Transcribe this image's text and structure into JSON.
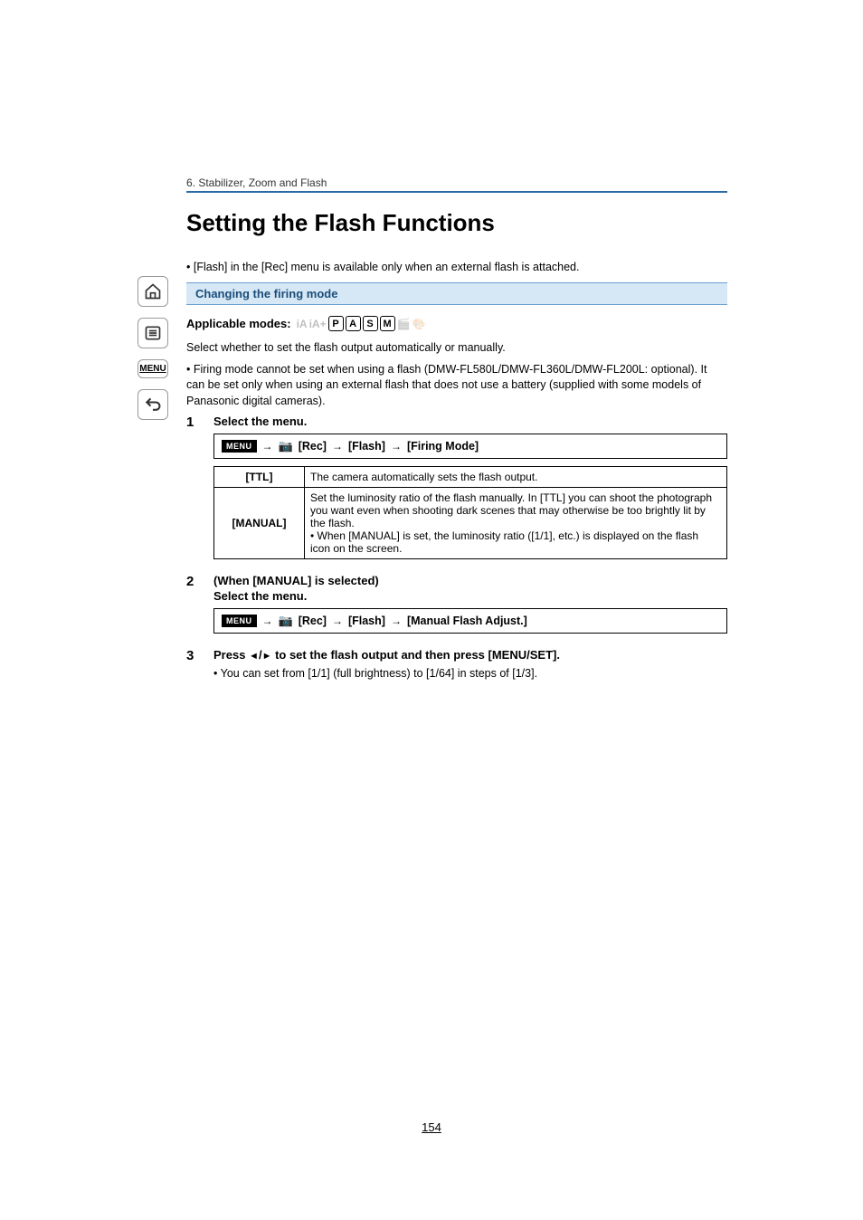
{
  "sidebar": {
    "menu_label": "MENU"
  },
  "header": {
    "section": "6. Stabilizer, Zoom and Flash"
  },
  "title": "Setting the Flash Functions",
  "note_flash": "• [Flash] in the [Rec] menu is available only when an external flash is attached.",
  "subheading": "Changing the firing mode",
  "applicable_label": "Applicable modes:",
  "body": {
    "p1": "Select whether to set the flash output automatically or manually.",
    "p2": "• Firing mode cannot be set when using a flash (DMW-FL580L/DMW-FL360L/DMW-FL200L: optional). It can be set only when using an external flash that does not use a battery (supplied with some models of Panasonic digital cameras)."
  },
  "steps": {
    "s1": {
      "num": "1",
      "title": "Select the menu.",
      "menu_label": "MENU",
      "path": {
        "a": "[Rec]",
        "b": "[Flash]",
        "c": "[Firing Mode]"
      },
      "options": [
        {
          "label": "[TTL]",
          "desc": "The camera automatically sets the flash output."
        },
        {
          "label": "[MANUAL]",
          "desc": "Set the luminosity ratio of the flash manually. In [TTL] you can shoot the photograph you want even when shooting dark scenes that may otherwise be too brightly lit by the flash.\n• When [MANUAL] is set, the luminosity ratio ([1/1], etc.) is displayed on the flash icon on the screen."
        }
      ]
    },
    "s2": {
      "num": "2",
      "title1": "(When [MANUAL] is selected)",
      "title2": "Select the menu.",
      "menu_label": "MENU",
      "path": {
        "a": "[Rec]",
        "b": "[Flash]",
        "c": "[Manual Flash Adjust.]"
      }
    },
    "s3": {
      "num": "3",
      "title_pre": "Press ",
      "title_post": " to set the flash output and then press [MENU/SET].",
      "sub": "• You can set from [1/1] (full brightness) to [1/64] in steps of [1/3]."
    }
  },
  "page_number": "154"
}
